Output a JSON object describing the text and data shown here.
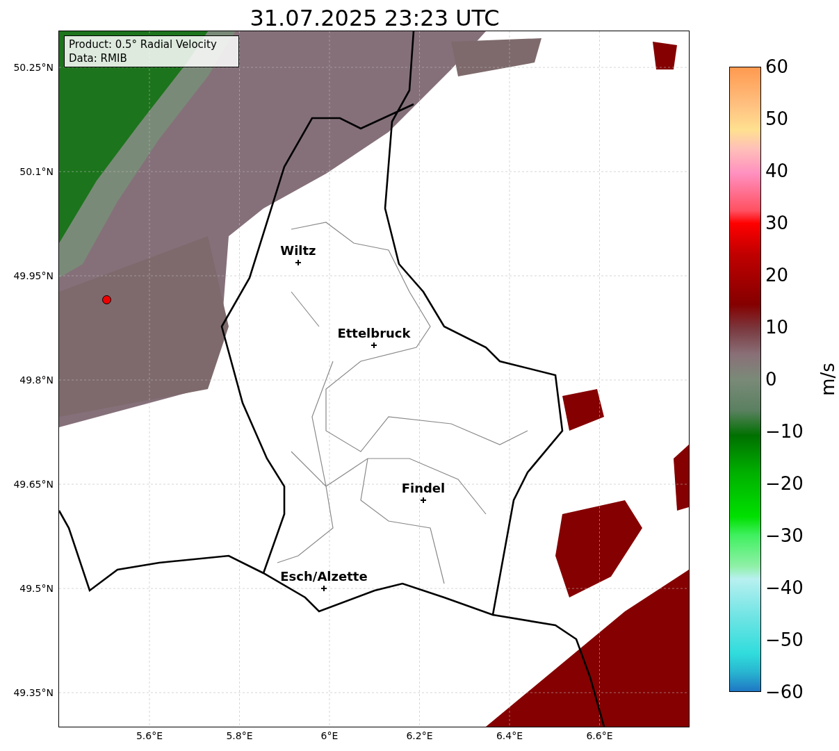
{
  "title": "31.07.2025 23:23 UTC",
  "map": {
    "legend": [
      "Product: 0.5° Radial Velocity",
      "Data: RMIB"
    ],
    "cities": [
      {
        "name": "Wiltz"
      },
      {
        "name": "Ettelbruck"
      },
      {
        "name": "Findel"
      },
      {
        "name": "Esch/Alzette"
      }
    ],
    "lat_ticks": [
      "50.25°N",
      "50.1°N",
      "49.95°N",
      "49.8°N",
      "49.65°N",
      "49.5°N",
      "49.35°N"
    ],
    "lon_ticks": [
      "5.6°E",
      "5.8°E",
      "6°E",
      "6.2°E",
      "6.4°E",
      "6.6°E"
    ]
  },
  "colorbar": {
    "label": "m/s",
    "ticks": [
      "60",
      "50",
      "40",
      "30",
      "20",
      "10",
      "0",
      "−10",
      "−20",
      "−30",
      "−40",
      "−50",
      "−60"
    ]
  }
}
